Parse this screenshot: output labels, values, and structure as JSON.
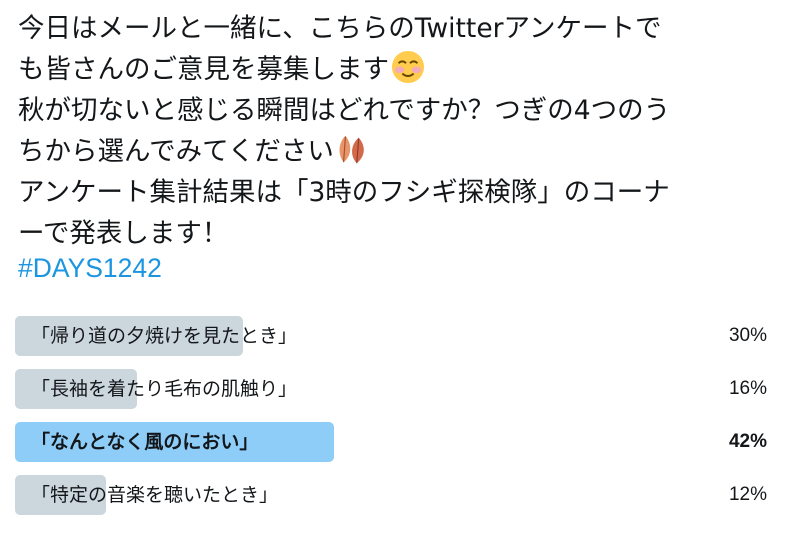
{
  "tweet": {
    "lines": [
      "今日はメールと一緒に、こちらのTwitterアンケートで",
      "も皆さんのご意見を募集します",
      "秋が切ないと感じる瞬間はどれですか？つぎの4つのう",
      "ちから選んでみてください",
      "アンケート集計結果は「3時のフシギ探検隊」のコーナ",
      "ーで発表します！"
    ],
    "emoji_1": "smiling-face-emoji",
    "emoji_2": "fallen-leaves-emoji",
    "hashtag": "#DAYS1242"
  },
  "poll": {
    "options": [
      {
        "label": "「帰り道の夕焼けを見たとき」",
        "percent": "30%",
        "fraction": 0.3,
        "winner": false
      },
      {
        "label": "「長袖を着たり毛布の肌触り」",
        "percent": "16%",
        "fraction": 0.16,
        "winner": false
      },
      {
        "label": "「なんとなく風のにおい」",
        "percent": "42%",
        "fraction": 0.42,
        "winner": true
      },
      {
        "label": "「特定の音楽を聴いたとき」",
        "percent": "12%",
        "fraction": 0.12,
        "winner": false
      }
    ]
  },
  "colors": {
    "text": "#14171a",
    "hashtag": "#1b95e0",
    "bar": "#ccd6dd",
    "bar_winner": "#8ecdf8"
  }
}
